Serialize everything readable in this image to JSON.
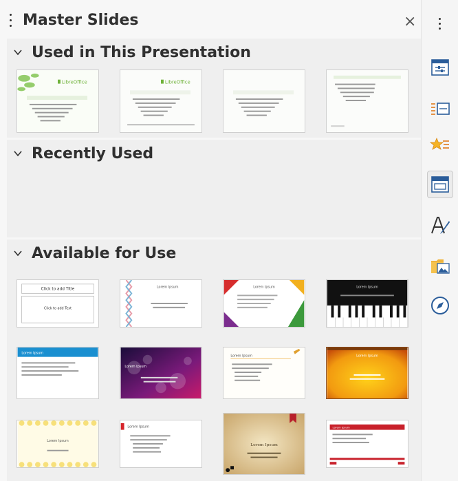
{
  "panel": {
    "title": "Master Slides",
    "close_glyph": "×"
  },
  "sections": {
    "used": {
      "label": "Used in This Presentation",
      "icon": "chevron-down-icon"
    },
    "recent": {
      "label": "Recently Used",
      "icon": "chevron-down-icon"
    },
    "available": {
      "label": "Available for Use",
      "icon": "chevron-down-icon"
    }
  },
  "thumb_text": {
    "click_title": "Click to add Title",
    "click_text": "Click to add Text",
    "lorem": "Lorem Ipsum",
    "lorem_body": "Lorem ipsum dolor sit amet, consectetur adipiscing elit.",
    "lo_logo": "LibreOffice",
    "click_title_format": "Click to edit the title text format",
    "click_outline": "Click to edit the outline text format"
  },
  "sidebar_icons": [
    "properties-icon",
    "slide-transition-icon",
    "animation-icon",
    "master-slides-icon",
    "styles-icon",
    "gallery-icon",
    "navigator-icon"
  ],
  "colors": {
    "accent_green": "#6fb23a",
    "accent_blue": "#1a73c8"
  }
}
